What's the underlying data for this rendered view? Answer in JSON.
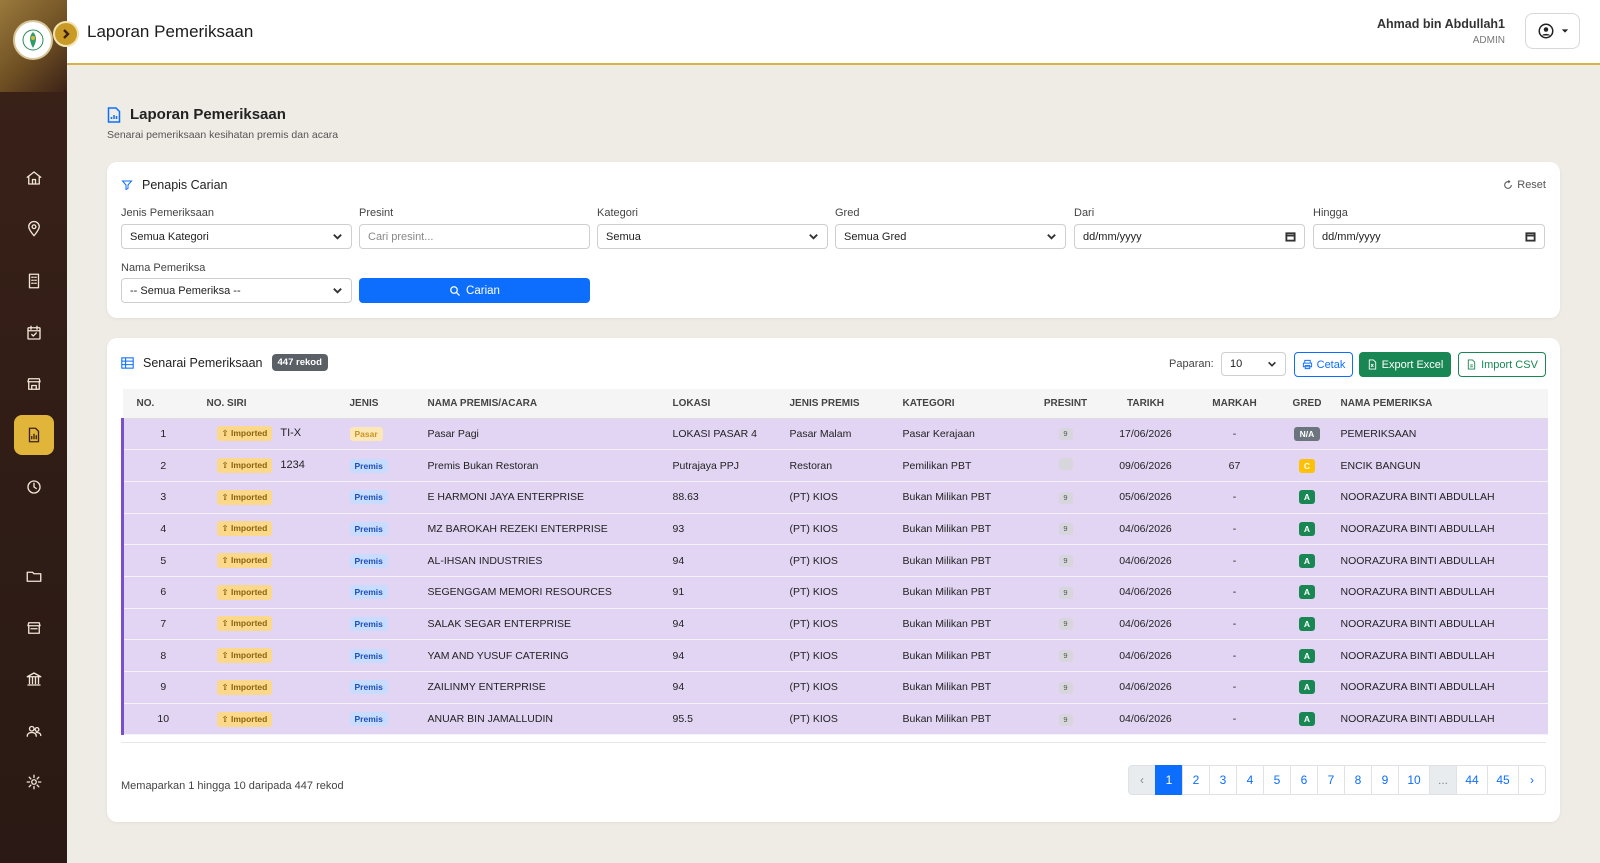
{
  "header": {
    "title": "Laporan Pemeriksaan",
    "user_name": "Ahmad bin Abdullah1",
    "user_role": "ADMIN"
  },
  "page": {
    "title": "Laporan Pemeriksaan",
    "subtitle": "Senarai pemeriksaan kesihatan premis dan acara"
  },
  "filter": {
    "title": "Penapis Carian",
    "reset_label": "Reset",
    "jenis_label": "Jenis Pemeriksaan",
    "jenis_value": "Semua Kategori",
    "presint_label": "Presint",
    "presint_placeholder": "Cari presint...",
    "kategori_label": "Kategori",
    "kategori_value": "Semua",
    "gred_label": "Gred",
    "gred_value": "Semua Gred",
    "dari_label": "Dari",
    "dari_placeholder": "dd/mm/yyyy",
    "hingga_label": "Hingga",
    "hingga_placeholder": "dd/mm/yyyy",
    "pemeriksa_label": "Nama Pemeriksa",
    "pemeriksa_value": "-- Semua Pemeriksa --",
    "search_label": "Carian"
  },
  "list": {
    "title": "Senarai Pemeriksaan",
    "count_badge": "447 rekod",
    "paparan_label": "Paparan:",
    "paparan_value": "10",
    "cetak_label": "Cetak",
    "excel_label": "Export Excel",
    "csv_label": "Import CSV",
    "columns": [
      "NO.",
      "NO. SIRI",
      "JENIS",
      "NAMA PREMIS/ACARA",
      "LOKASI",
      "JENIS PREMIS",
      "KATEGORI",
      "PRESINT",
      "TARIKH",
      "MARKAH",
      "GRED",
      "NAMA PEMERIKSA"
    ],
    "rows": [
      {
        "no": "1",
        "imported": "Imported",
        "siri": "TI-X",
        "jenis": "Pasar",
        "nama": "Pasar Pagi",
        "lokasi": "LOKASI PASAR 4",
        "jenis_premis": "Pasar Malam",
        "kategori": "Pasar Kerajaan",
        "presint": "9",
        "tarikh": "17/06/2026",
        "markah": "-",
        "gred": "N/A",
        "pemeriksa": "PEMERIKSAAN"
      },
      {
        "no": "2",
        "imported": "Imported",
        "siri": "1234",
        "jenis": "Premis",
        "nama": "Premis Bukan Restoran",
        "lokasi": "Putrajaya PPJ",
        "jenis_premis": "Restoran",
        "kategori": "Pemilikan PBT",
        "presint": "",
        "tarikh": "09/06/2026",
        "markah": "67",
        "gred": "C",
        "pemeriksa": "ENCIK BANGUN"
      },
      {
        "no": "3",
        "imported": "Imported",
        "siri": "",
        "jenis": "Premis",
        "nama": "E HARMONI JAYA ENTERPRISE",
        "lokasi": "88.63",
        "jenis_premis": "(PT) KIOS",
        "kategori": "Bukan Milikan PBT",
        "presint": "9",
        "tarikh": "05/06/2026",
        "markah": "-",
        "gred": "A",
        "pemeriksa": "NOORAZURA BINTI ABDULLAH"
      },
      {
        "no": "4",
        "imported": "Imported",
        "siri": "",
        "jenis": "Premis",
        "nama": "MZ BAROKAH REZEKI ENTERPRISE",
        "lokasi": "93",
        "jenis_premis": "(PT) KIOS",
        "kategori": "Bukan Milikan PBT",
        "presint": "9",
        "tarikh": "04/06/2026",
        "markah": "-",
        "gred": "A",
        "pemeriksa": "NOORAZURA BINTI ABDULLAH"
      },
      {
        "no": "5",
        "imported": "Imported",
        "siri": "",
        "jenis": "Premis",
        "nama": "AL-IHSAN INDUSTRIES",
        "lokasi": "94",
        "jenis_premis": "(PT) KIOS",
        "kategori": "Bukan Milikan PBT",
        "presint": "9",
        "tarikh": "04/06/2026",
        "markah": "-",
        "gred": "A",
        "pemeriksa": "NOORAZURA BINTI ABDULLAH"
      },
      {
        "no": "6",
        "imported": "Imported",
        "siri": "",
        "jenis": "Premis",
        "nama": "SEGENGGAM MEMORI RESOURCES",
        "lokasi": "91",
        "jenis_premis": "(PT) KIOS",
        "kategori": "Bukan Milikan PBT",
        "presint": "9",
        "tarikh": "04/06/2026",
        "markah": "-",
        "gred": "A",
        "pemeriksa": "NOORAZURA BINTI ABDULLAH"
      },
      {
        "no": "7",
        "imported": "Imported",
        "siri": "",
        "jenis": "Premis",
        "nama": "SALAK SEGAR ENTERPRISE",
        "lokasi": "94",
        "jenis_premis": "(PT) KIOS",
        "kategori": "Bukan Milikan PBT",
        "presint": "9",
        "tarikh": "04/06/2026",
        "markah": "-",
        "gred": "A",
        "pemeriksa": "NOORAZURA BINTI ABDULLAH"
      },
      {
        "no": "8",
        "imported": "Imported",
        "siri": "",
        "jenis": "Premis",
        "nama": "YAM AND YUSUF CATERING",
        "lokasi": "94",
        "jenis_premis": "(PT) KIOS",
        "kategori": "Bukan Milikan PBT",
        "presint": "9",
        "tarikh": "04/06/2026",
        "markah": "-",
        "gred": "A",
        "pemeriksa": "NOORAZURA BINTI ABDULLAH"
      },
      {
        "no": "9",
        "imported": "Imported",
        "siri": "",
        "jenis": "Premis",
        "nama": "ZAILINMY ENTERPRISE",
        "lokasi": "94",
        "jenis_premis": "(PT) KIOS",
        "kategori": "Bukan Milikan PBT",
        "presint": "9",
        "tarikh": "04/06/2026",
        "markah": "-",
        "gred": "A",
        "pemeriksa": "NOORAZURA BINTI ABDULLAH"
      },
      {
        "no": "10",
        "imported": "Imported",
        "siri": "",
        "jenis": "Premis",
        "nama": "ANUAR BIN JAMALLUDIN",
        "lokasi": "95.5",
        "jenis_premis": "(PT) KIOS",
        "kategori": "Bukan Milikan PBT",
        "presint": "9",
        "tarikh": "04/06/2026",
        "markah": "-",
        "gred": "A",
        "pemeriksa": "NOORAZURA BINTI ABDULLAH"
      }
    ],
    "showing_text": "Memaparkan 1 hingga 10 daripada 447 rekod",
    "pagination": [
      "‹",
      "1",
      "2",
      "3",
      "4",
      "5",
      "6",
      "7",
      "8",
      "9",
      "10",
      "...",
      "44",
      "45",
      "›"
    ],
    "active_page": "1"
  },
  "colors": {
    "primary": "#0d6efd",
    "success": "#198754",
    "sidebar": "#3b2218",
    "accent": "#e1b53a",
    "row_highlight": "#e2d5f3"
  },
  "icons": {
    "sidebar": [
      "home-icon",
      "map-pin-icon",
      "building-icon",
      "calendar-check-icon",
      "store-icon",
      "report-icon",
      "clock-icon",
      "folder-icon",
      "shop-icon",
      "bank-icon",
      "users-icon",
      "settings-icon"
    ]
  }
}
